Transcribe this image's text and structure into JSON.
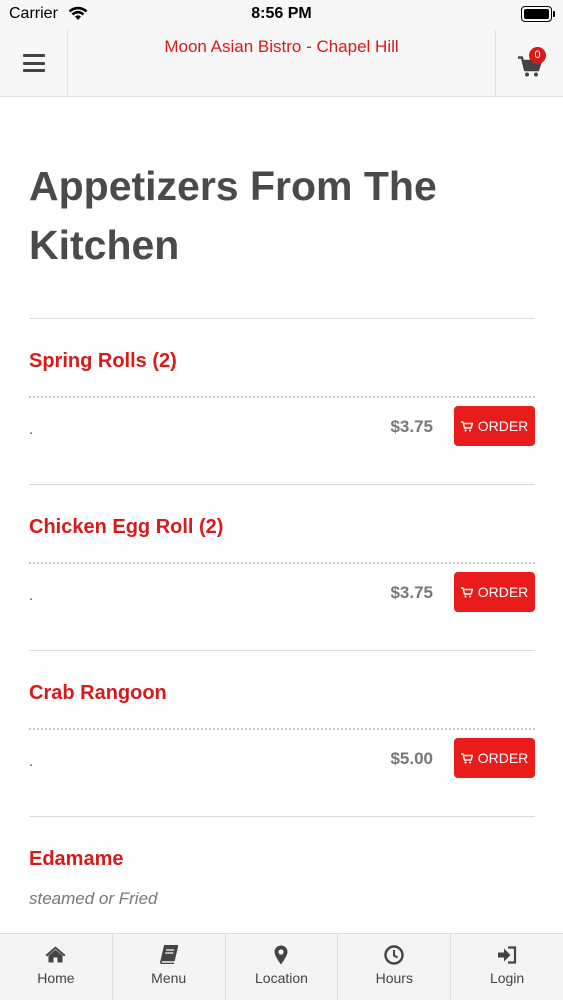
{
  "status_bar": {
    "carrier": "Carrier",
    "time": "8:56 PM"
  },
  "header": {
    "title": "Moon Asian Bistro - Chapel Hill",
    "cart_count": "0",
    "menu_icon": "hamburger-icon",
    "cart_icon": "cart-icon"
  },
  "section": {
    "title": "Appetizers From The Kitchen"
  },
  "items": [
    {
      "name": "Spring Rolls (2)",
      "description": ".",
      "price": "$3.75",
      "order_label": "ORDER"
    },
    {
      "name": "Chicken Egg Roll (2)",
      "description": ".",
      "price": "$3.75",
      "order_label": "ORDER"
    },
    {
      "name": "Crab Rangoon",
      "description": ".",
      "price": "$5.00",
      "order_label": "ORDER"
    },
    {
      "name": "Edamame",
      "description": "steamed or Fried"
    }
  ],
  "tabs": [
    {
      "label": "Home",
      "icon": "home-icon"
    },
    {
      "label": "Menu",
      "icon": "book-icon"
    },
    {
      "label": "Location",
      "icon": "map-pin-icon"
    },
    {
      "label": "Hours",
      "icon": "clock-icon"
    },
    {
      "label": "Login",
      "icon": "login-icon"
    }
  ],
  "colors": {
    "brand_red": "#d71a1a",
    "button_red": "#ea1b1b",
    "heading_gray": "#4a4a4a"
  }
}
